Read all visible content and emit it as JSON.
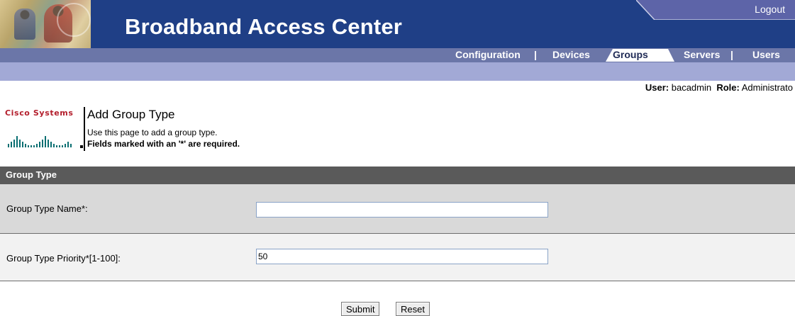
{
  "header": {
    "title": "Broadband Access Center",
    "logout_label": "Logout",
    "banner_color": "#1f3f86"
  },
  "nav": {
    "items": [
      {
        "label": "Configuration"
      },
      {
        "label": "Devices"
      },
      {
        "label": "Groups",
        "active": true
      },
      {
        "label": "Servers"
      },
      {
        "label": "Users"
      }
    ],
    "separator": "|",
    "color": "#6b76a8"
  },
  "userbar": {
    "user_label": "User:",
    "user_value": "bacadmin",
    "role_label": "Role:",
    "role_value": "Administrato"
  },
  "branding": {
    "logo_text": "Cisco Systems"
  },
  "page": {
    "title": "Add Group Type",
    "description": "Use this page to add a group type.",
    "required_note": "Fields marked with an '*' are required."
  },
  "form": {
    "section_title": "Group Type",
    "fields": [
      {
        "label": "Group Type Name*:",
        "value": "",
        "placeholder": ""
      },
      {
        "label": "Group Type Priority*[1-100]:",
        "value": "50",
        "placeholder": ""
      }
    ],
    "submit_label": "Submit",
    "reset_label": "Reset"
  }
}
